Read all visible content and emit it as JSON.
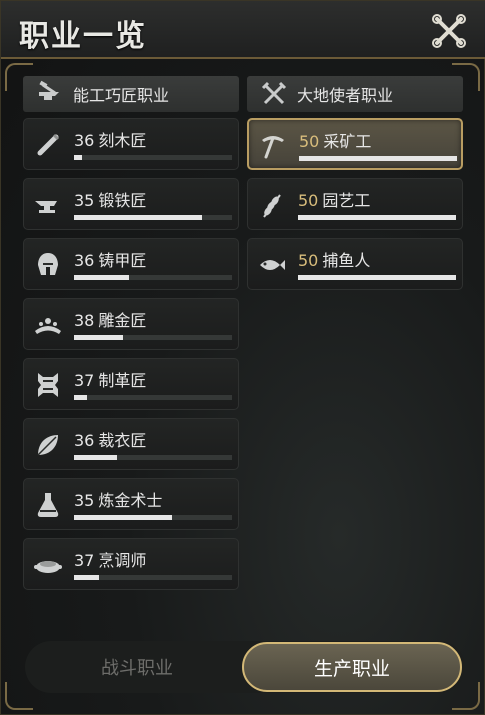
{
  "window": {
    "title": "职业一览"
  },
  "columns": {
    "craftsman": {
      "label": "能工巧匠职业",
      "icon": "anvil-hammer-icon"
    },
    "earth": {
      "label": "大地使者职业",
      "icon": "crossed-tools-icon"
    }
  },
  "craft_jobs": [
    {
      "level": "36",
      "name": "刻木匠",
      "icon": "carving-tool-icon",
      "progress": 0.05
    },
    {
      "level": "35",
      "name": "锻铁匠",
      "icon": "anvil-icon",
      "progress": 0.81
    },
    {
      "level": "36",
      "name": "铸甲匠",
      "icon": "helmet-icon",
      "progress": 0.35
    },
    {
      "level": "38",
      "name": "雕金匠",
      "icon": "tiara-icon",
      "progress": 0.31
    },
    {
      "level": "37",
      "name": "制革匠",
      "icon": "leather-hide-icon",
      "progress": 0.08
    },
    {
      "level": "36",
      "name": "裁衣匠",
      "icon": "needle-leaf-icon",
      "progress": 0.27
    },
    {
      "level": "35",
      "name": "炼金术士",
      "icon": "flask-icon",
      "progress": 0.62
    },
    {
      "level": "37",
      "name": "烹调师",
      "icon": "cooking-pot-icon",
      "progress": 0.16
    }
  ],
  "earth_jobs": [
    {
      "level": "50",
      "name": "采矿工",
      "icon": "pickaxe-icon",
      "progress": 1.0,
      "selected": true
    },
    {
      "level": "50",
      "name": "园艺工",
      "icon": "wheat-icon",
      "progress": 1.0,
      "selected": false
    },
    {
      "level": "50",
      "name": "捕鱼人",
      "icon": "fish-icon",
      "progress": 1.0,
      "selected": false
    }
  ],
  "tabs": {
    "combat": "战斗职业",
    "production": "生产职业"
  },
  "colors": {
    "accent_gold": "#b99d62",
    "level_gold": "#d8bd7c",
    "bar_fill": "#e6e6e6"
  }
}
